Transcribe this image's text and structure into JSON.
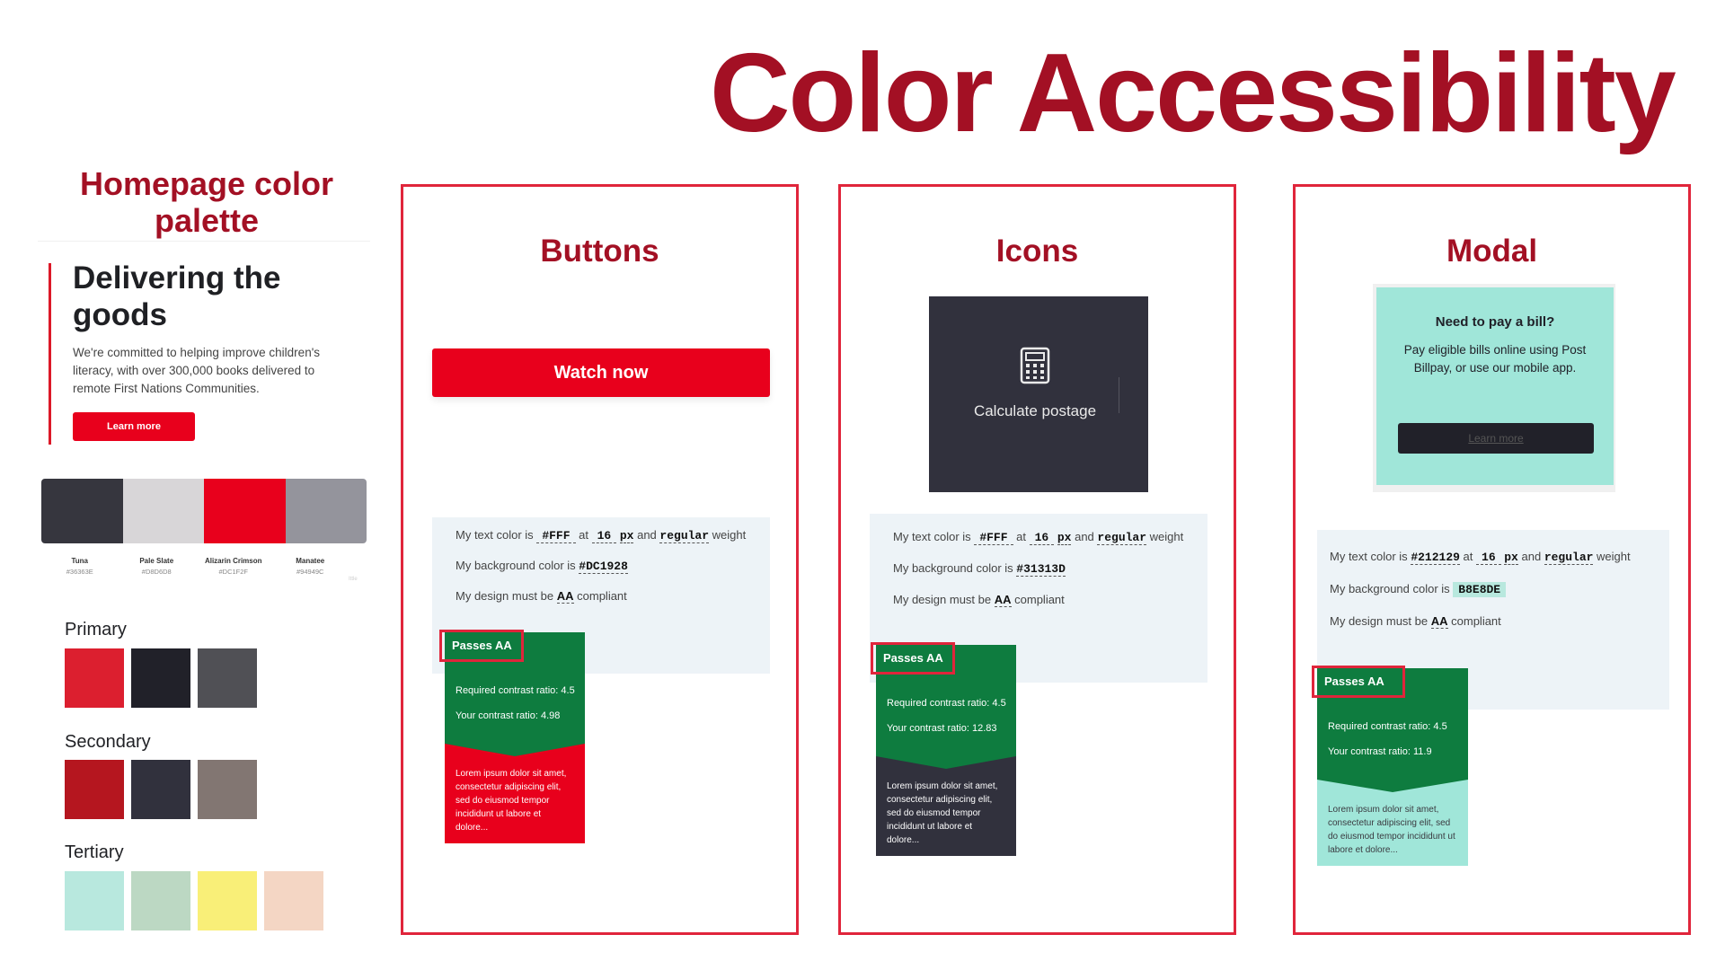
{
  "title": "Color Accessibility",
  "left": {
    "heading": "Homepage color palette",
    "hero": {
      "title": "Delivering the goods",
      "body": "We're committed to helping improve children's literacy, with over 300,000 books delivered to remote First Nations Communities.",
      "button": "Learn more"
    },
    "swatches": [
      {
        "name": "Tuna",
        "hex": "#36363E",
        "color": "#36363e"
      },
      {
        "name": "Pale Slate",
        "hex": "#D8D6D8",
        "color": "#d8d6d8"
      },
      {
        "name": "Alizarin Crimson",
        "hex": "#DC1F2F",
        "color": "#e8001c"
      },
      {
        "name": "Manatee",
        "hex": "#94949C",
        "color": "#94949c"
      }
    ],
    "swatch_note": "Ittle",
    "groups": [
      {
        "label": "Primary",
        "colors": [
          "#dc1f2f",
          "#212129",
          "#505055"
        ]
      },
      {
        "label": "Secondary",
        "colors": [
          "#b5161f",
          "#31313d",
          "#827672"
        ]
      },
      {
        "label": "Tertiary",
        "colors": [
          "#b8e8de",
          "#bcd8c3",
          "#f9ef78",
          "#f4d6c4"
        ]
      }
    ]
  },
  "common": {
    "text_color_prefix": "My text color is",
    "at": "at",
    "px": "px",
    "and": "and",
    "weight_value": "regular",
    "weight_suffix": "weight",
    "bg_prefix": "My background color is",
    "design_prefix": "My design must be",
    "design_level": "AA",
    "design_suffix": "compliant",
    "passes": "Passes AA",
    "required_label": "Required contrast ratio: 4.5",
    "lorem": "Lorem ipsum dolor sit amet, consectetur adipiscing elit, sed do eiusmod tempor incididunt ut labore et dolore..."
  },
  "panels": {
    "buttons": {
      "title": "Buttons",
      "button_label": "Watch now",
      "text_color": "#FFF",
      "size": "16",
      "bg_color": "#DC1928",
      "your_ratio": "Your contrast ratio: 4.98",
      "preview_bg": "#e8001c"
    },
    "icons": {
      "title": "Icons",
      "tile_label": "Calculate postage",
      "icon": "calculator-icon",
      "text_color": "#FFF",
      "size": "16",
      "bg_color": "#31313D",
      "your_ratio": "Your contrast ratio: 12.83",
      "preview_bg": "#31313d"
    },
    "modal": {
      "title": "Modal",
      "modal_title": "Need to pay a bill?",
      "modal_body": "Pay eligible bills online using Post Billpay, or use our mobile app.",
      "modal_button": "Learn more",
      "text_color": "#212129",
      "size": "16",
      "bg_color": "B8E8DE",
      "your_ratio": "Your contrast ratio: 11.9",
      "preview_bg": "#a0e6d9"
    }
  }
}
